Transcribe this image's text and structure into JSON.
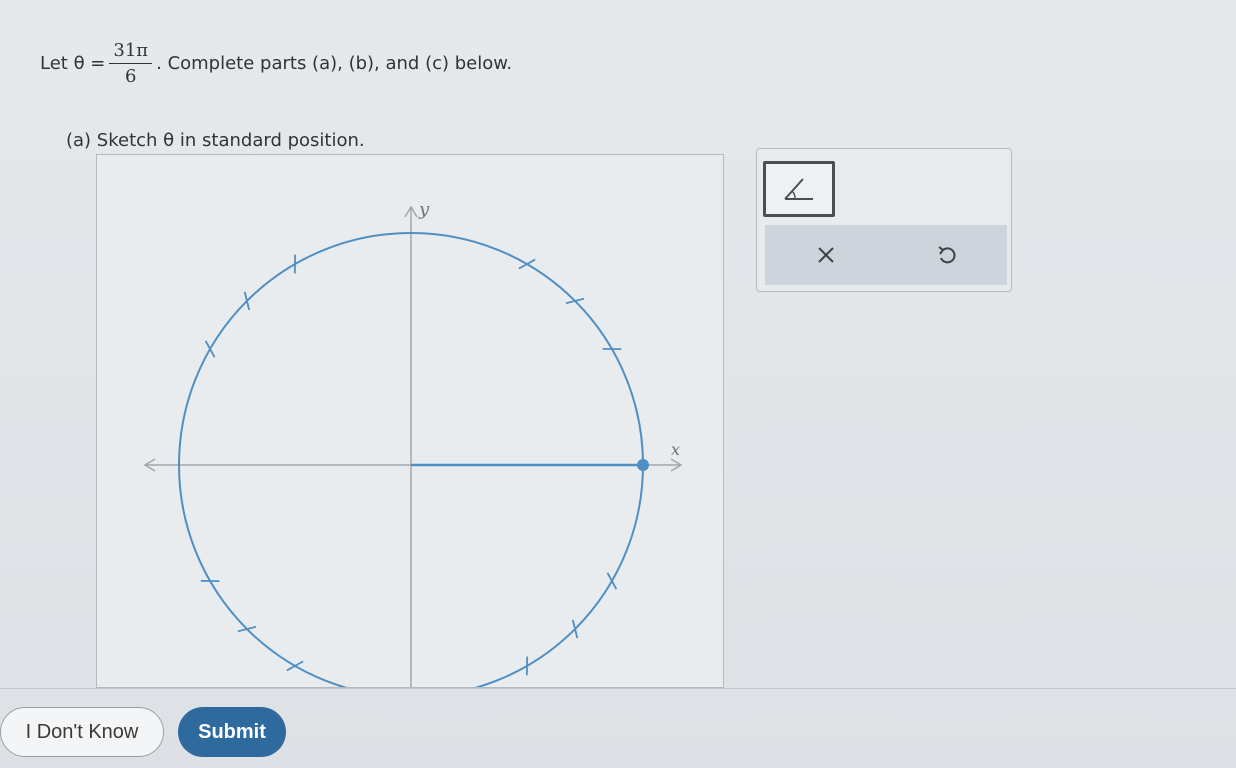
{
  "question": {
    "prefix": "Let θ =",
    "numerator": "31π",
    "denominator": "6",
    "suffix": ". Complete parts (a), (b), and (c) below."
  },
  "part_a": {
    "label": "(a) Sketch θ in standard position."
  },
  "graph": {
    "x_axis_label": "x",
    "y_axis_label": "y",
    "tick_angles_deg": [
      30,
      45,
      60,
      120,
      135,
      150,
      210,
      225,
      240,
      300,
      315,
      330
    ],
    "terminal_point_angle_deg": 0,
    "circle_color": "#4f8fc3",
    "axis_color": "#9fa6ad"
  },
  "tools": {
    "angle_tool_icon": "angle-icon",
    "delete_icon": "x-icon",
    "undo_icon": "undo-icon"
  },
  "buttons": {
    "dont_know": "I Don't Know",
    "submit": "Submit"
  },
  "colors": {
    "accent": "#2f6a9e",
    "circle": "#4f8fc3"
  }
}
